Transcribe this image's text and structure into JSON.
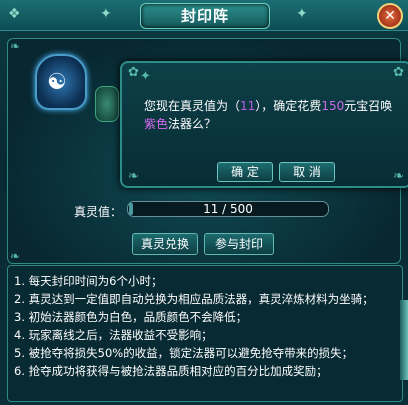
{
  "window": {
    "title": "封印阵",
    "close_label": "✕"
  },
  "main": {
    "spirit_label": "真灵值：",
    "spirit_value": "11 / 500",
    "spirit_fraction": 0.022,
    "buttons": {
      "exchange": "真灵兑换",
      "join": "参与封印"
    }
  },
  "rules": [
    "1. 每天封印时间为6个小时；",
    "2. 真灵达到一定值即自动兑换为相应品质法器，真灵淬炼材料为坐骑；",
    "3. 初始法器颜色为白色，品质颜色不会降低；",
    "4. 玩家离线之后，法器收益不受影响；",
    "5. 被抢夺将损失50%的收益，锁定法器可以避免抢夺带来的损失；",
    "6. 抢夺成功将获得与被抢法器品质相对应的百分比加成奖励；"
  ],
  "dialog": {
    "part1": "您现在真灵值为（",
    "value": "11",
    "part2": "），确定花费",
    "cost": "150",
    "part3": "元宝召唤",
    "color_word": "紫色",
    "part4": "法器么？",
    "confirm": "确 定",
    "cancel": "取 消"
  },
  "icons": {
    "seal": "yin-yang-seal-icon",
    "close": "close-icon"
  },
  "colors": {
    "accent": "#2c8d88",
    "highlight": "#c96be8"
  }
}
